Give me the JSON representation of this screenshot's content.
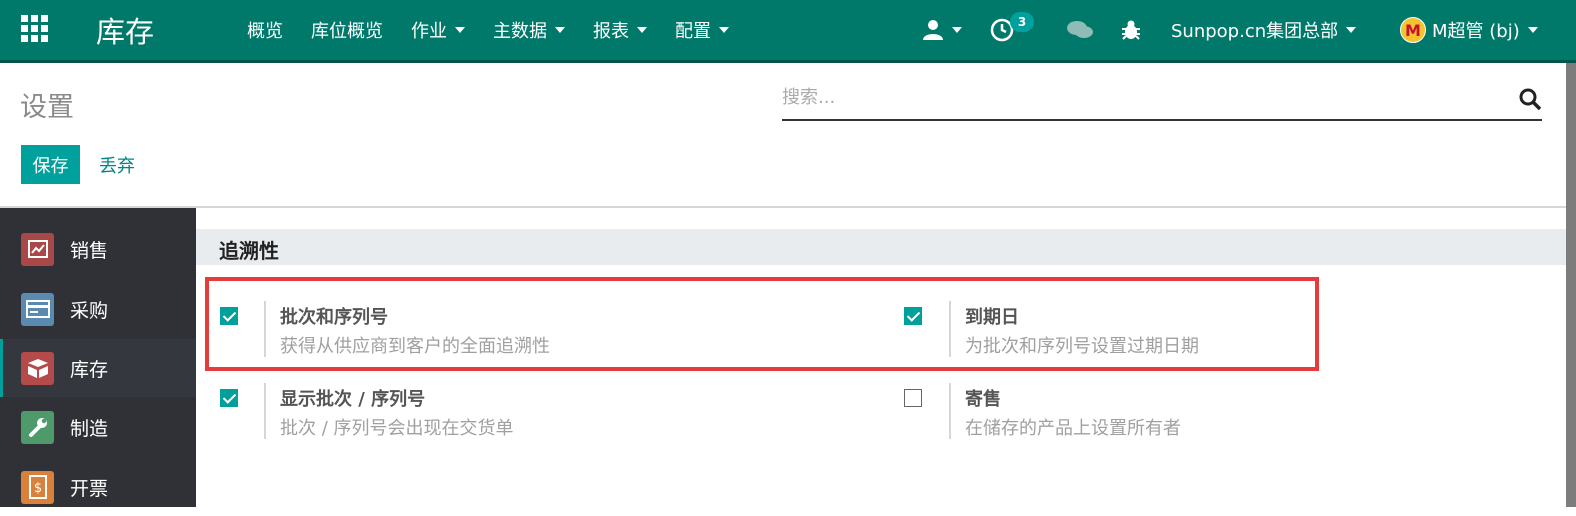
{
  "app": {
    "name": "库存",
    "menu": [
      {
        "label": "概览",
        "dropdown": false
      },
      {
        "label": "库位概览",
        "dropdown": false
      },
      {
        "label": "作业",
        "dropdown": true
      },
      {
        "label": "主数据",
        "dropdown": true
      },
      {
        "label": "报表",
        "dropdown": true
      },
      {
        "label": "配置",
        "dropdown": true
      }
    ],
    "activity_count": "3",
    "company": "Sunpop.cn集团总部",
    "user": "M超管 (bj)"
  },
  "control": {
    "title": "设置",
    "search_placeholder": "搜索...",
    "save_label": "保存",
    "discard_label": "丢弃"
  },
  "sidebar": {
    "items": [
      {
        "label": "销售",
        "icon": "sales-chart-icon",
        "color": "#a84848"
      },
      {
        "label": "采购",
        "icon": "purchase-card-icon",
        "color": "#5b8ab1"
      },
      {
        "label": "库存",
        "icon": "inventory-box-icon",
        "color": "#b54a4a",
        "active": true
      },
      {
        "label": "制造",
        "icon": "manufacturing-wrench-icon",
        "color": "#4f9a6b"
      },
      {
        "label": "开票",
        "icon": "invoice-document-icon",
        "color": "#d9803b"
      }
    ]
  },
  "section": {
    "title": "追溯性",
    "settings": [
      {
        "title": "批次和序列号",
        "desc": "获得从供应商到客户的全面追溯性",
        "checked": true
      },
      {
        "title": "到期日",
        "desc": "为批次和序列号设置过期日期",
        "checked": true
      },
      {
        "title": "显示批次 / 序列号",
        "desc": "批次 / 序列号会出现在交货单",
        "checked": true
      },
      {
        "title": "寄售",
        "desc": "在储存的产品上设置所有者",
        "checked": false
      }
    ]
  },
  "colors": {
    "navbar": "#00796b",
    "accent": "#00a09d",
    "highlight": "#e63b3b",
    "sidebar": "#2f3136"
  }
}
